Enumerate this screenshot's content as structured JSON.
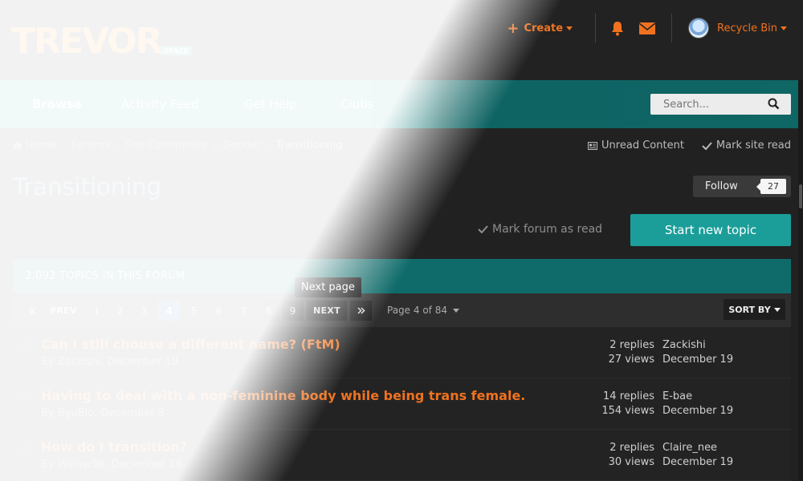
{
  "logo": {
    "main": "TREVOR",
    "sub": "SPACE"
  },
  "user_bar": {
    "create_label": "Create",
    "bell_icon": "bell-icon",
    "mail_icon": "envelope-icon",
    "user_name": "Recycle Bin"
  },
  "nav": {
    "items": [
      "Browse",
      "Activity Feed",
      "Get Help",
      "Clubs"
    ],
    "search_placeholder": "Search..."
  },
  "breadcrumb": {
    "items": [
      "Home",
      "Forums",
      "The Community",
      "Gender",
      "Transitioning"
    ]
  },
  "crumb_actions": {
    "unread": "Unread Content",
    "mark_site": "Mark site read"
  },
  "title": "Transitioning",
  "follow": {
    "label": "Follow",
    "count": "27"
  },
  "mark_forum": "Mark forum as read",
  "start_topic": "Start new topic",
  "forum_head": "2,092 TOPICS IN THIS FORUM",
  "pager": {
    "prev": "PREV",
    "next": "NEXT",
    "pages": [
      "1",
      "2",
      "3",
      "4",
      "5",
      "6",
      "7",
      "8",
      "9"
    ],
    "current": "4",
    "page_of": "Page 4 of 84",
    "sort": "SORT BY",
    "tooltip": "Next page"
  },
  "topics": [
    {
      "title": "Can i still choose a different name? (FtM)",
      "meta": "By Zackishi, December 19",
      "replies": "2 replies",
      "views": "27 views",
      "last_user": "Zackishi",
      "last_date": "December 19"
    },
    {
      "title": "Having to deal with a non-feminine body while being trans female.",
      "meta": "By ByuBio, December 8",
      "replies": "14 replies",
      "views": "154 views",
      "last_user": "E-bae",
      "last_date": "December 19"
    },
    {
      "title": "How do I transition?",
      "meta": "By Willow98, December 18",
      "replies": "2 replies",
      "views": "30 views",
      "last_user": "Claire_nee",
      "last_date": "December 19"
    }
  ],
  "colors": {
    "accent": "#f0721f",
    "teal": "#1b9e9a",
    "dark_teal": "#0f6b69",
    "current_page": "#1d5fa8",
    "title_blue": "#7aa6d6"
  }
}
